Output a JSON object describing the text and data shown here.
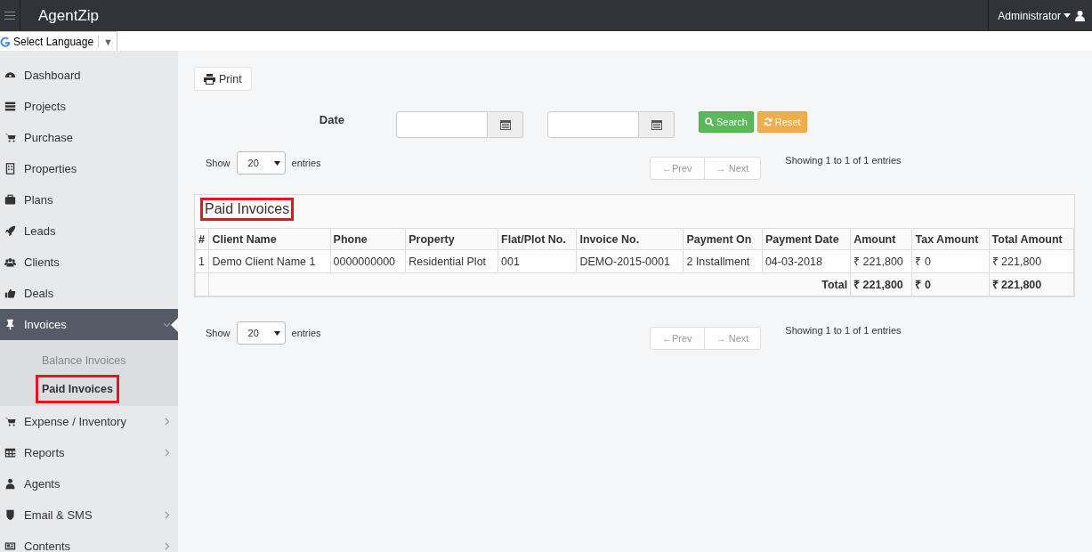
{
  "topbar": {
    "brand": "AgentZip",
    "user": "Administrator"
  },
  "language": {
    "label": "Select Language",
    "caret": "▼"
  },
  "sidebar": {
    "items": [
      {
        "label": "Dashboard",
        "selected": false
      },
      {
        "label": "Projects",
        "selected": false
      },
      {
        "label": "Purchase",
        "selected": false
      },
      {
        "label": "Properties",
        "selected": false
      },
      {
        "label": "Plans",
        "selected": false
      },
      {
        "label": "Leads",
        "selected": false
      },
      {
        "label": "Clients",
        "selected": false
      },
      {
        "label": "Deals",
        "selected": false
      },
      {
        "label": "Invoices",
        "selected": true,
        "expanded": true,
        "children": [
          {
            "label": "Balance Invoices",
            "selected": false,
            "highlighted": false
          },
          {
            "label": "Paid Invoices",
            "selected": true,
            "highlighted": true
          }
        ]
      },
      {
        "label": "Expense / Inventory",
        "selected": false,
        "expanded": false
      },
      {
        "label": "Reports",
        "selected": false,
        "expanded": false
      },
      {
        "label": "Agents",
        "selected": false
      },
      {
        "label": "Email & SMS",
        "selected": false,
        "expanded": false
      },
      {
        "label": "Contents",
        "selected": false,
        "expanded": false
      }
    ]
  },
  "print_button": "Print",
  "filter": {
    "label": "Date",
    "search": "Search",
    "reset": "Reset"
  },
  "pagers": [
    {
      "show": "Show",
      "page_size": "20",
      "entries": "entries",
      "prev": "←Prev",
      "next": "→ Next",
      "prev_disabled": true,
      "next_disabled": true,
      "info": "Showing 1 to 1 of 1 entries"
    },
    {
      "show": "Show",
      "page_size": "20",
      "entries": "entries",
      "prev": "←Prev",
      "next": "→ Next",
      "prev_disabled": true,
      "next_disabled": true,
      "info": "Showing 1 to 1 of 1 entries"
    }
  ],
  "table": {
    "title": "Paid Invoices",
    "title_highlighted": true,
    "columns": [
      "#",
      "Client Name",
      "Phone",
      "Property",
      "Flat/Plot No.",
      "Invoice No.",
      "Payment On",
      "Payment Date",
      "Amount",
      "Tax Amount",
      "Total Amount"
    ],
    "rows": [
      [
        "1",
        "Demo Client Name 1",
        "0000000000",
        "Residential Plot",
        "001",
        "DEMO-2015-0001",
        "2 Installment",
        "04-03-2018",
        "₹ 221,800",
        "₹ 0",
        "₹ 221,800"
      ]
    ],
    "total": {
      "label": "Total",
      "amount": "₹ 221,800",
      "tax": "₹ 0",
      "total": "₹ 221,800"
    }
  }
}
